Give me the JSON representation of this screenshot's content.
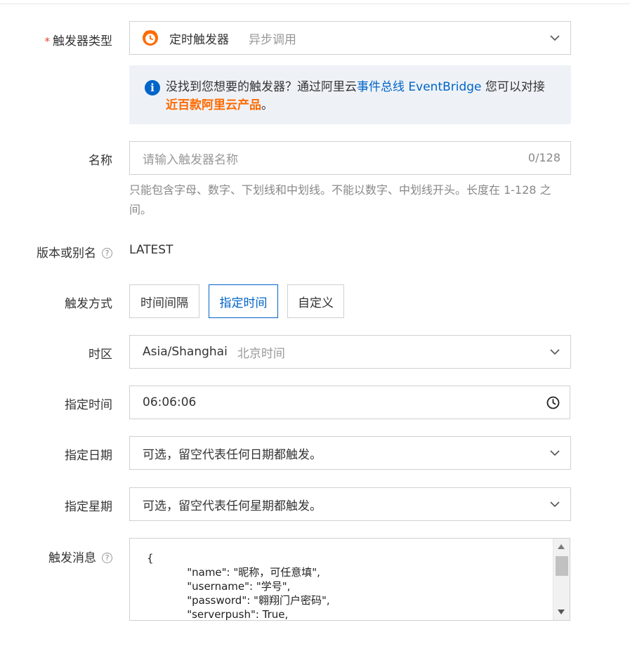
{
  "trigger_type": {
    "label": "触发器类型",
    "required_mark": "*",
    "value": "定时触发器",
    "sub": "异步调用",
    "icon": "alarm-clock-icon"
  },
  "info": {
    "text_1": "没找到您想要的触发器？通过阿里云",
    "link": "事件总线 EventBridge",
    "text_2": " 您可以对接",
    "highlight": "近百款阿里云产品",
    "text_3": "。",
    "icon": "info-icon"
  },
  "name_field": {
    "label": "名称",
    "placeholder": "请输入触发器名称",
    "counter": "0/128",
    "hint": "只能包含字母、数字、下划线和中划线。不能以数字、中划线开头。长度在 1-128 之间。"
  },
  "version": {
    "label": "版本或别名",
    "value": "LATEST"
  },
  "trigger_mode": {
    "label": "触发方式",
    "options": [
      "时间间隔",
      "指定时间",
      "自定义"
    ],
    "selected": "指定时间"
  },
  "timezone": {
    "label": "时区",
    "value": "Asia/Shanghai",
    "sub": "北京时间"
  },
  "time": {
    "label": "指定时间",
    "value": "06:06:06"
  },
  "date": {
    "label": "指定日期",
    "placeholder": "可选，留空代表任何日期都触发。"
  },
  "weekday": {
    "label": "指定星期",
    "placeholder": "可选，留空代表任何星期都触发。"
  },
  "message": {
    "label": "触发消息",
    "lines": [
      "{",
      "            \"name\": \"昵称，可任意填\",",
      "            \"username\": \"学号\",",
      "            \"password\": \"翱翔门户密码\",",
      "            \"serverpush\": True,"
    ]
  },
  "colors": {
    "primary": "#0064c8",
    "accent": "#ff6a00",
    "required": "#e8432b"
  }
}
